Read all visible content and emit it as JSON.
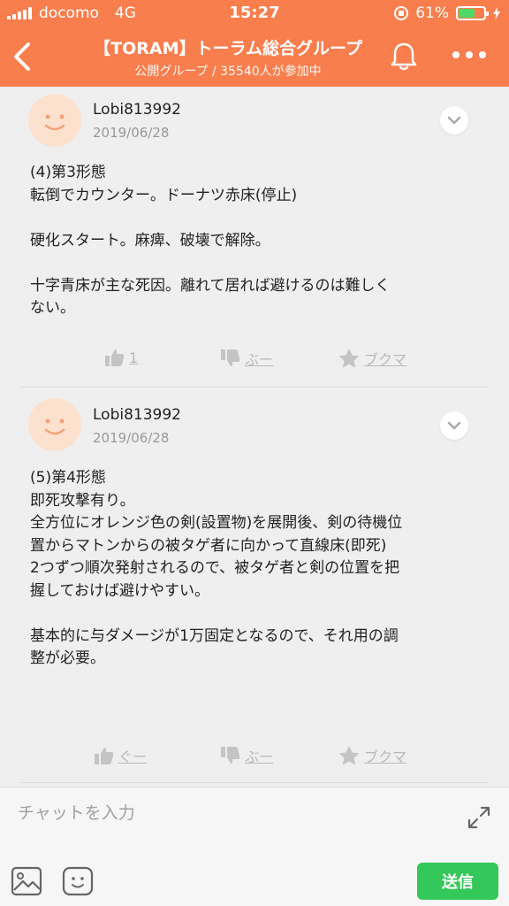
{
  "status_bar": {
    "carrier": "docomo",
    "network": "4G",
    "time": "15:27",
    "battery": "61%"
  },
  "header": {
    "title": "【TORAM】トーラム総合グループ",
    "subtitle": "公開グループ / 35540人が参加中"
  },
  "posts": [
    {
      "user": "Lobi813992",
      "date": "2019/06/28",
      "text": "(4)第3形態\n転倒でカウンター。ドーナツ赤床(停止)\n\n硬化スタート。麻痺、破壊で解除。\n\n十字青床が主な死因。離れて居れば避けるのは難しく\nない。",
      "like_label": "1",
      "dislike_label": "ぶー",
      "bookmark_label": "ブクマ"
    },
    {
      "user": "Lobi813992",
      "date": "2019/06/28",
      "text": "(5)第4形態\n即死攻撃有り。\n全方位にオレンジ色の剣(設置物)を展開後、剣の待機位\n置からマトンからの被タゲ者に向かって直線床(即死)\n2つずつ順次発射されるので、被タゲ者と剣の位置を把\n握しておけば避けやすい。\n\n基本的に与ダメージが1万固定となるので、それ用の調\n整が必要。",
      "like_label": "ぐー",
      "dislike_label": "ぶー",
      "bookmark_label": "ブクマ"
    }
  ],
  "composer": {
    "placeholder": "チャットを入力",
    "send_label": "送信"
  },
  "colors": {
    "header": "#f97e4d",
    "send": "#34c759",
    "avatar": "#fde1cf",
    "action": "#b9b9b9"
  }
}
